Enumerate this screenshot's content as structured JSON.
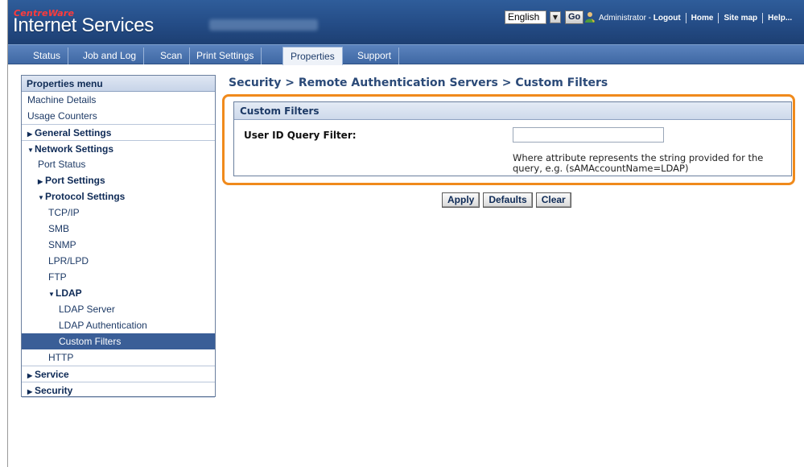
{
  "header": {
    "brand": "CentreWare",
    "product": "Internet Services",
    "language": {
      "selected": "English",
      "go_label": "Go"
    },
    "user": {
      "name": "Administrator",
      "separator": " - ",
      "logout": "Logout"
    },
    "links": [
      "Home",
      "Site map",
      "Help..."
    ]
  },
  "tabs": [
    "Status",
    "Job and Log",
    "Scan",
    "Print Settings",
    "Properties",
    "Support"
  ],
  "sidebar": {
    "title": "Properties menu",
    "items": [
      {
        "label": "Machine Details"
      },
      {
        "label": "Usage Counters"
      },
      {
        "label": "General Settings",
        "arrow": "▶"
      },
      {
        "label": "Network Settings",
        "arrow": "▼"
      },
      {
        "label": "Port Status"
      },
      {
        "label": "Port Settings",
        "arrow": "▶"
      },
      {
        "label": "Protocol Settings",
        "arrow": "▼"
      },
      {
        "label": "TCP/IP"
      },
      {
        "label": "SMB"
      },
      {
        "label": "SNMP"
      },
      {
        "label": "LPR/LPD"
      },
      {
        "label": "FTP"
      },
      {
        "label": "LDAP",
        "arrow": "▼"
      },
      {
        "label": "LDAP Server"
      },
      {
        "label": "LDAP Authentication"
      },
      {
        "label": "Custom Filters"
      },
      {
        "label": "HTTP"
      },
      {
        "label": "Service",
        "arrow": "▶"
      },
      {
        "label": "Security",
        "arrow": "▶"
      }
    ]
  },
  "content": {
    "breadcrumb": "Security > Remote Authentication Servers > Custom Filters",
    "panel_title": "Custom Filters",
    "field_label": "User ID Query Filter:",
    "field_value": "",
    "field_hint": "Where attribute represents the string provided for the query, e.g. (sAMAccountName=LDAP)",
    "buttons": {
      "apply": "Apply",
      "defaults": "Defaults",
      "clear": "Clear"
    }
  },
  "colors": {
    "header_bg": "#244c86",
    "tab_bg": "#4a74b0",
    "highlight": "#f08a1c",
    "selected_item": "#3a5e97"
  }
}
